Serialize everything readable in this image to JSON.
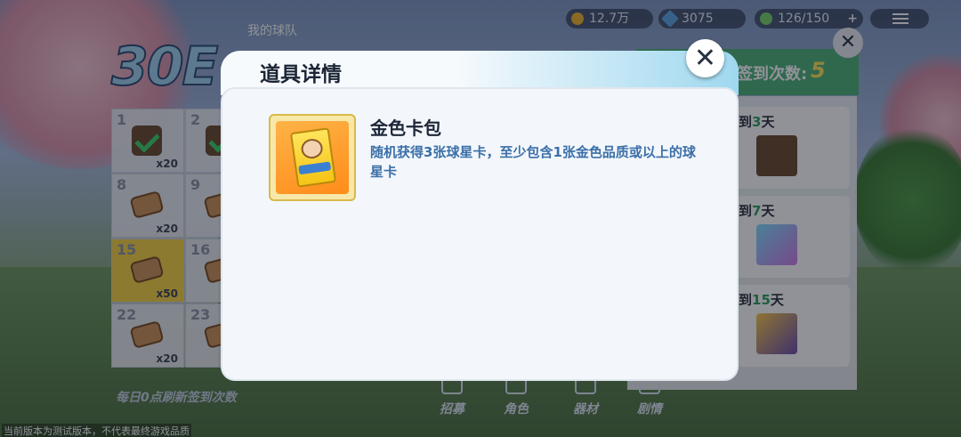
{
  "background": {
    "hud": {
      "coins": "12.7万",
      "gems": "3075",
      "stamina": "126/150",
      "stamina_plus": "+"
    },
    "tab_label": "我的球队",
    "big_number": "30E",
    "calendar": {
      "cells": [
        {
          "num": "1",
          "qty": "x20",
          "state": "checked"
        },
        {
          "num": "2",
          "qty": "",
          "state": "checked"
        },
        {
          "num": "8",
          "qty": "x20",
          "state": "item"
        },
        {
          "num": "9",
          "qty": "",
          "state": "item"
        },
        {
          "num": "15",
          "qty": "x50",
          "state": "gold"
        },
        {
          "num": "16",
          "qty": "",
          "state": "item"
        },
        {
          "num": "22",
          "qty": "x20",
          "state": "item"
        },
        {
          "num": "23",
          "qty": "",
          "state": "item"
        }
      ]
    },
    "rewards": {
      "header_text": "可签到次数:",
      "header_count": "5",
      "rows": [
        {
          "prefix": "签到",
          "days": "3",
          "suffix": "天"
        },
        {
          "prefix": "签到",
          "days": "7",
          "suffix": "天"
        },
        {
          "prefix": "签到",
          "days": "15",
          "suffix": "天"
        }
      ]
    },
    "refresh_note": "每日0点刷新签到次数",
    "nav": [
      "招募",
      "角色",
      "器材",
      "剧情"
    ],
    "disclaimer": "当前版本为测试版本，不代表最终游戏品质"
  },
  "modal": {
    "title": "道具详情",
    "close_glyph": "✕",
    "item": {
      "name": "金色卡包",
      "description": "随机获得3张球星卡，至少包含1张金色品质或以上的球星卡"
    }
  },
  "colors": {
    "accent_green": "#2fa35e",
    "desc_blue": "#3b6fa8",
    "gold": "#f6d444"
  }
}
